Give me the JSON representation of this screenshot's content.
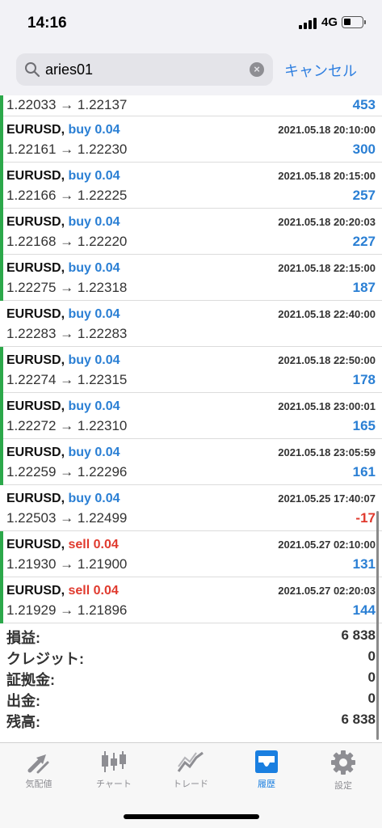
{
  "status": {
    "time": "14:16",
    "network": "4G"
  },
  "search": {
    "value": "aries01",
    "cancel_label": "キャンセル"
  },
  "first_row": {
    "prices": "1.22033 → 1.22137",
    "profit": "453"
  },
  "trades": [
    {
      "symbol": "EURUSD,",
      "side": "buy 0.04",
      "type": "buy",
      "date": "2021.05.18 20:10:00",
      "prices": "1.22161 → 1.22230",
      "profit": "300",
      "bar": true
    },
    {
      "symbol": "EURUSD,",
      "side": "buy 0.04",
      "type": "buy",
      "date": "2021.05.18 20:15:00",
      "prices": "1.22166 → 1.22225",
      "profit": "257",
      "bar": true
    },
    {
      "symbol": "EURUSD,",
      "side": "buy 0.04",
      "type": "buy",
      "date": "2021.05.18 20:20:03",
      "prices": "1.22168 → 1.22220",
      "profit": "227",
      "bar": true
    },
    {
      "symbol": "EURUSD,",
      "side": "buy 0.04",
      "type": "buy",
      "date": "2021.05.18 22:15:00",
      "prices": "1.22275 → 1.22318",
      "profit": "187",
      "bar": true
    },
    {
      "symbol": "EURUSD,",
      "side": "buy 0.04",
      "type": "buy",
      "date": "2021.05.18 22:40:00",
      "prices": "1.22283 → 1.22283",
      "profit": "",
      "bar": false
    },
    {
      "symbol": "EURUSD,",
      "side": "buy 0.04",
      "type": "buy",
      "date": "2021.05.18 22:50:00",
      "prices": "1.22274 → 1.22315",
      "profit": "178",
      "bar": true
    },
    {
      "symbol": "EURUSD,",
      "side": "buy 0.04",
      "type": "buy",
      "date": "2021.05.18 23:00:01",
      "prices": "1.22272 → 1.22310",
      "profit": "165",
      "bar": true
    },
    {
      "symbol": "EURUSD,",
      "side": "buy 0.04",
      "type": "buy",
      "date": "2021.05.18 23:05:59",
      "prices": "1.22259 → 1.22296",
      "profit": "161",
      "bar": true
    },
    {
      "symbol": "EURUSD,",
      "side": "buy 0.04",
      "type": "buy",
      "date": "2021.05.25 17:40:07",
      "prices": "1.22503 → 1.22499",
      "profit": "-17",
      "bar": false
    },
    {
      "symbol": "EURUSD,",
      "side": "sell 0.04",
      "type": "sell",
      "date": "2021.05.27 02:10:00",
      "prices": "1.21930 → 1.21900",
      "profit": "131",
      "bar": true
    },
    {
      "symbol": "EURUSD,",
      "side": "sell 0.04",
      "type": "sell",
      "date": "2021.05.27 02:20:03",
      "prices": "1.21929 → 1.21896",
      "profit": "144",
      "bar": true
    }
  ],
  "summary": [
    {
      "label": "損益:",
      "value": "6 838"
    },
    {
      "label": "クレジット:",
      "value": "0"
    },
    {
      "label": "証拠金:",
      "value": "0"
    },
    {
      "label": "出金:",
      "value": "0"
    },
    {
      "label": "残高:",
      "value": "6 838"
    }
  ],
  "tabs": [
    {
      "label": "気配値",
      "icon": "quotes-arrows-icon"
    },
    {
      "label": "チャート",
      "icon": "candlestick-chart-icon"
    },
    {
      "label": "トレード",
      "icon": "trade-chart-icon"
    },
    {
      "label": "履歴",
      "icon": "history-inbox-icon",
      "active": true
    },
    {
      "label": "設定",
      "icon": "settings-gear-icon"
    }
  ],
  "colors": {
    "accent_blue": "#2a7fd4",
    "sell_red": "#e03a2e",
    "profit_bar_green": "#2ca84a",
    "tab_active": "#1a7fe0",
    "tab_inactive": "#8e8e93"
  }
}
